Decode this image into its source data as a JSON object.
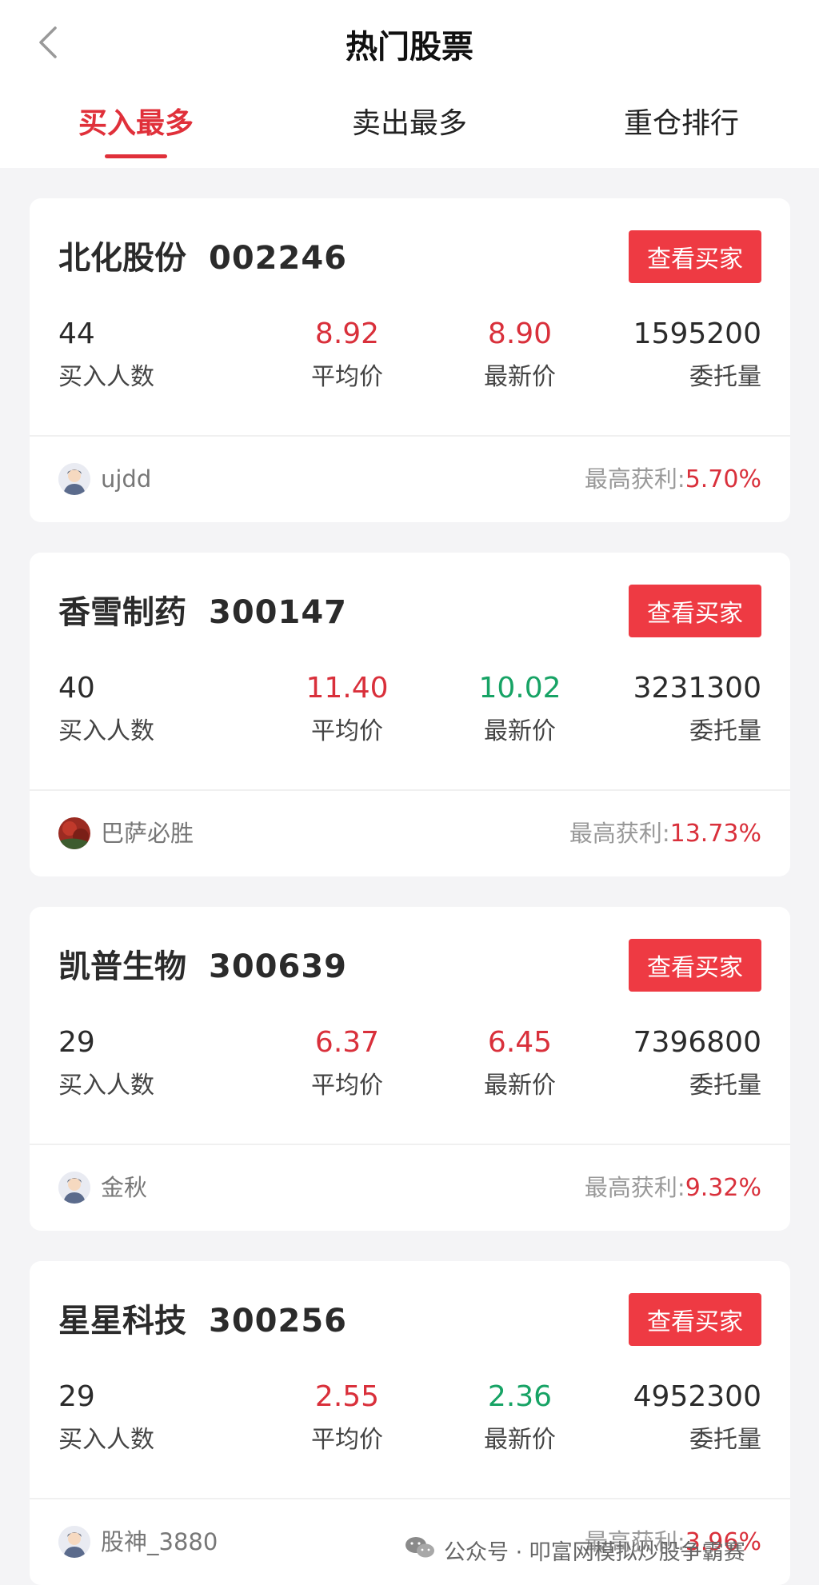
{
  "header": {
    "title": "热门股票"
  },
  "tabs": [
    {
      "label": "买入最多",
      "active": true
    },
    {
      "label": "卖出最多",
      "active": false
    },
    {
      "label": "重仓排行",
      "active": false
    }
  ],
  "labels": {
    "buyers": "买入人数",
    "avg_price": "平均价",
    "last_price": "最新价",
    "volume": "委托量",
    "view_buyers": "查看买家",
    "max_profit": "最高获利:"
  },
  "cards": [
    {
      "name": "北化股份",
      "code": "002246",
      "buyers": "44",
      "avg_price": "8.92",
      "last_price": "8.90",
      "volume": "1595200",
      "user": "ujdd",
      "profit": "5.70%",
      "last_price_color": "red"
    },
    {
      "name": "香雪制药",
      "code": "300147",
      "buyers": "40",
      "avg_price": "11.40",
      "last_price": "10.02",
      "volume": "3231300",
      "user": "巴萨必胜",
      "profit": "13.73%",
      "last_price_color": "green"
    },
    {
      "name": "凯普生物",
      "code": "300639",
      "buyers": "29",
      "avg_price": "6.37",
      "last_price": "6.45",
      "volume": "7396800",
      "user": "金秋",
      "profit": "9.32%",
      "last_price_color": "red"
    },
    {
      "name": "星星科技",
      "code": "300256",
      "buyers": "29",
      "avg_price": "2.55",
      "last_price": "2.36",
      "volume": "4952300",
      "user": "股神_3880",
      "profit": "3.96%",
      "last_price_color": "green"
    }
  ],
  "watermark": {
    "text": "公众号 · 叩富网模拟炒股争霸赛"
  },
  "colors": {
    "accent": "#ee3a43",
    "up": "#d9303b",
    "down": "#17a365"
  },
  "icons": {
    "back": "chevron-left-icon",
    "avatar": "user-avatar-icon",
    "watermark": "wechat-icon"
  }
}
